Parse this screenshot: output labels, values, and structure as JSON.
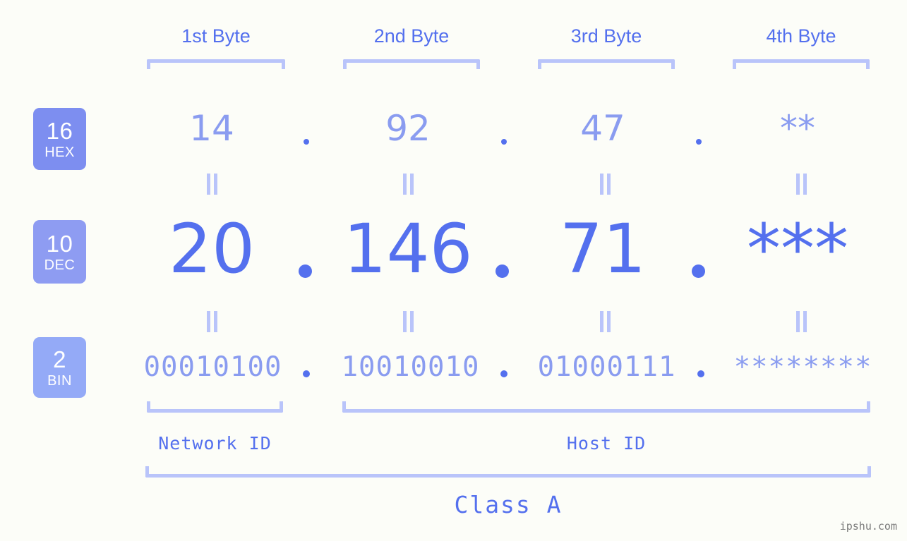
{
  "page": {
    "background_color": "#fcfdf8",
    "accent_color": "#5470ee",
    "muted_color": "#8a9cf0",
    "light_color": "#b9c4fa",
    "watermark": "ipshu.com"
  },
  "byte_headers": [
    {
      "label": "1st Byte"
    },
    {
      "label": "2nd Byte"
    },
    {
      "label": "3rd Byte"
    },
    {
      "label": "4th Byte"
    }
  ],
  "rows": [
    {
      "badge_number": "16",
      "badge_name": "HEX",
      "badge_color": "#7d8ef0",
      "values": [
        "14",
        "92",
        "47",
        "**"
      ],
      "separators": [
        ".",
        ".",
        "."
      ]
    },
    {
      "badge_number": "10",
      "badge_name": "DEC",
      "badge_color": "#8e9cf2",
      "values": [
        "20",
        "146",
        "71",
        "***"
      ],
      "separators": [
        ".",
        ".",
        "."
      ]
    },
    {
      "badge_number": "2",
      "badge_name": "BIN",
      "badge_color": "#94aaf7",
      "values": [
        "00010100",
        "10010010",
        "01000111",
        "********"
      ],
      "separators": [
        ".",
        ".",
        "."
      ]
    }
  ],
  "equals_symbol": "=",
  "footer": {
    "network_id_label": "Network ID",
    "host_id_label": "Host ID",
    "class_label": "Class A"
  },
  "address": {
    "hex": "14.92.47.**",
    "dec": "20.146.71.***",
    "bin": "00010100.10010010.01000111.********"
  }
}
